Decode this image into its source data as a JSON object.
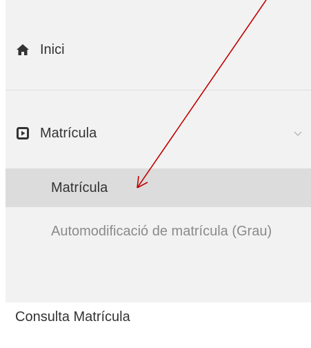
{
  "nav": {
    "home": {
      "label": "Inici",
      "icon": "home-icon"
    },
    "matricula": {
      "label": "Matrícula",
      "icon": "play-square-icon",
      "expanded": true
    },
    "submenu": [
      {
        "label": "Matrícula",
        "active": true
      },
      {
        "label": "Automodificació de matrícula (Grau)",
        "active": false
      }
    ],
    "consulta": {
      "label": "Consulta Matrícula"
    }
  },
  "annotation": {
    "arrow_color": "#c00000"
  },
  "colors": {
    "panel_bg": "#f2f2f2",
    "active_bg": "#dcdcdc",
    "text": "#333333",
    "muted_text": "#8a8a8a"
  }
}
